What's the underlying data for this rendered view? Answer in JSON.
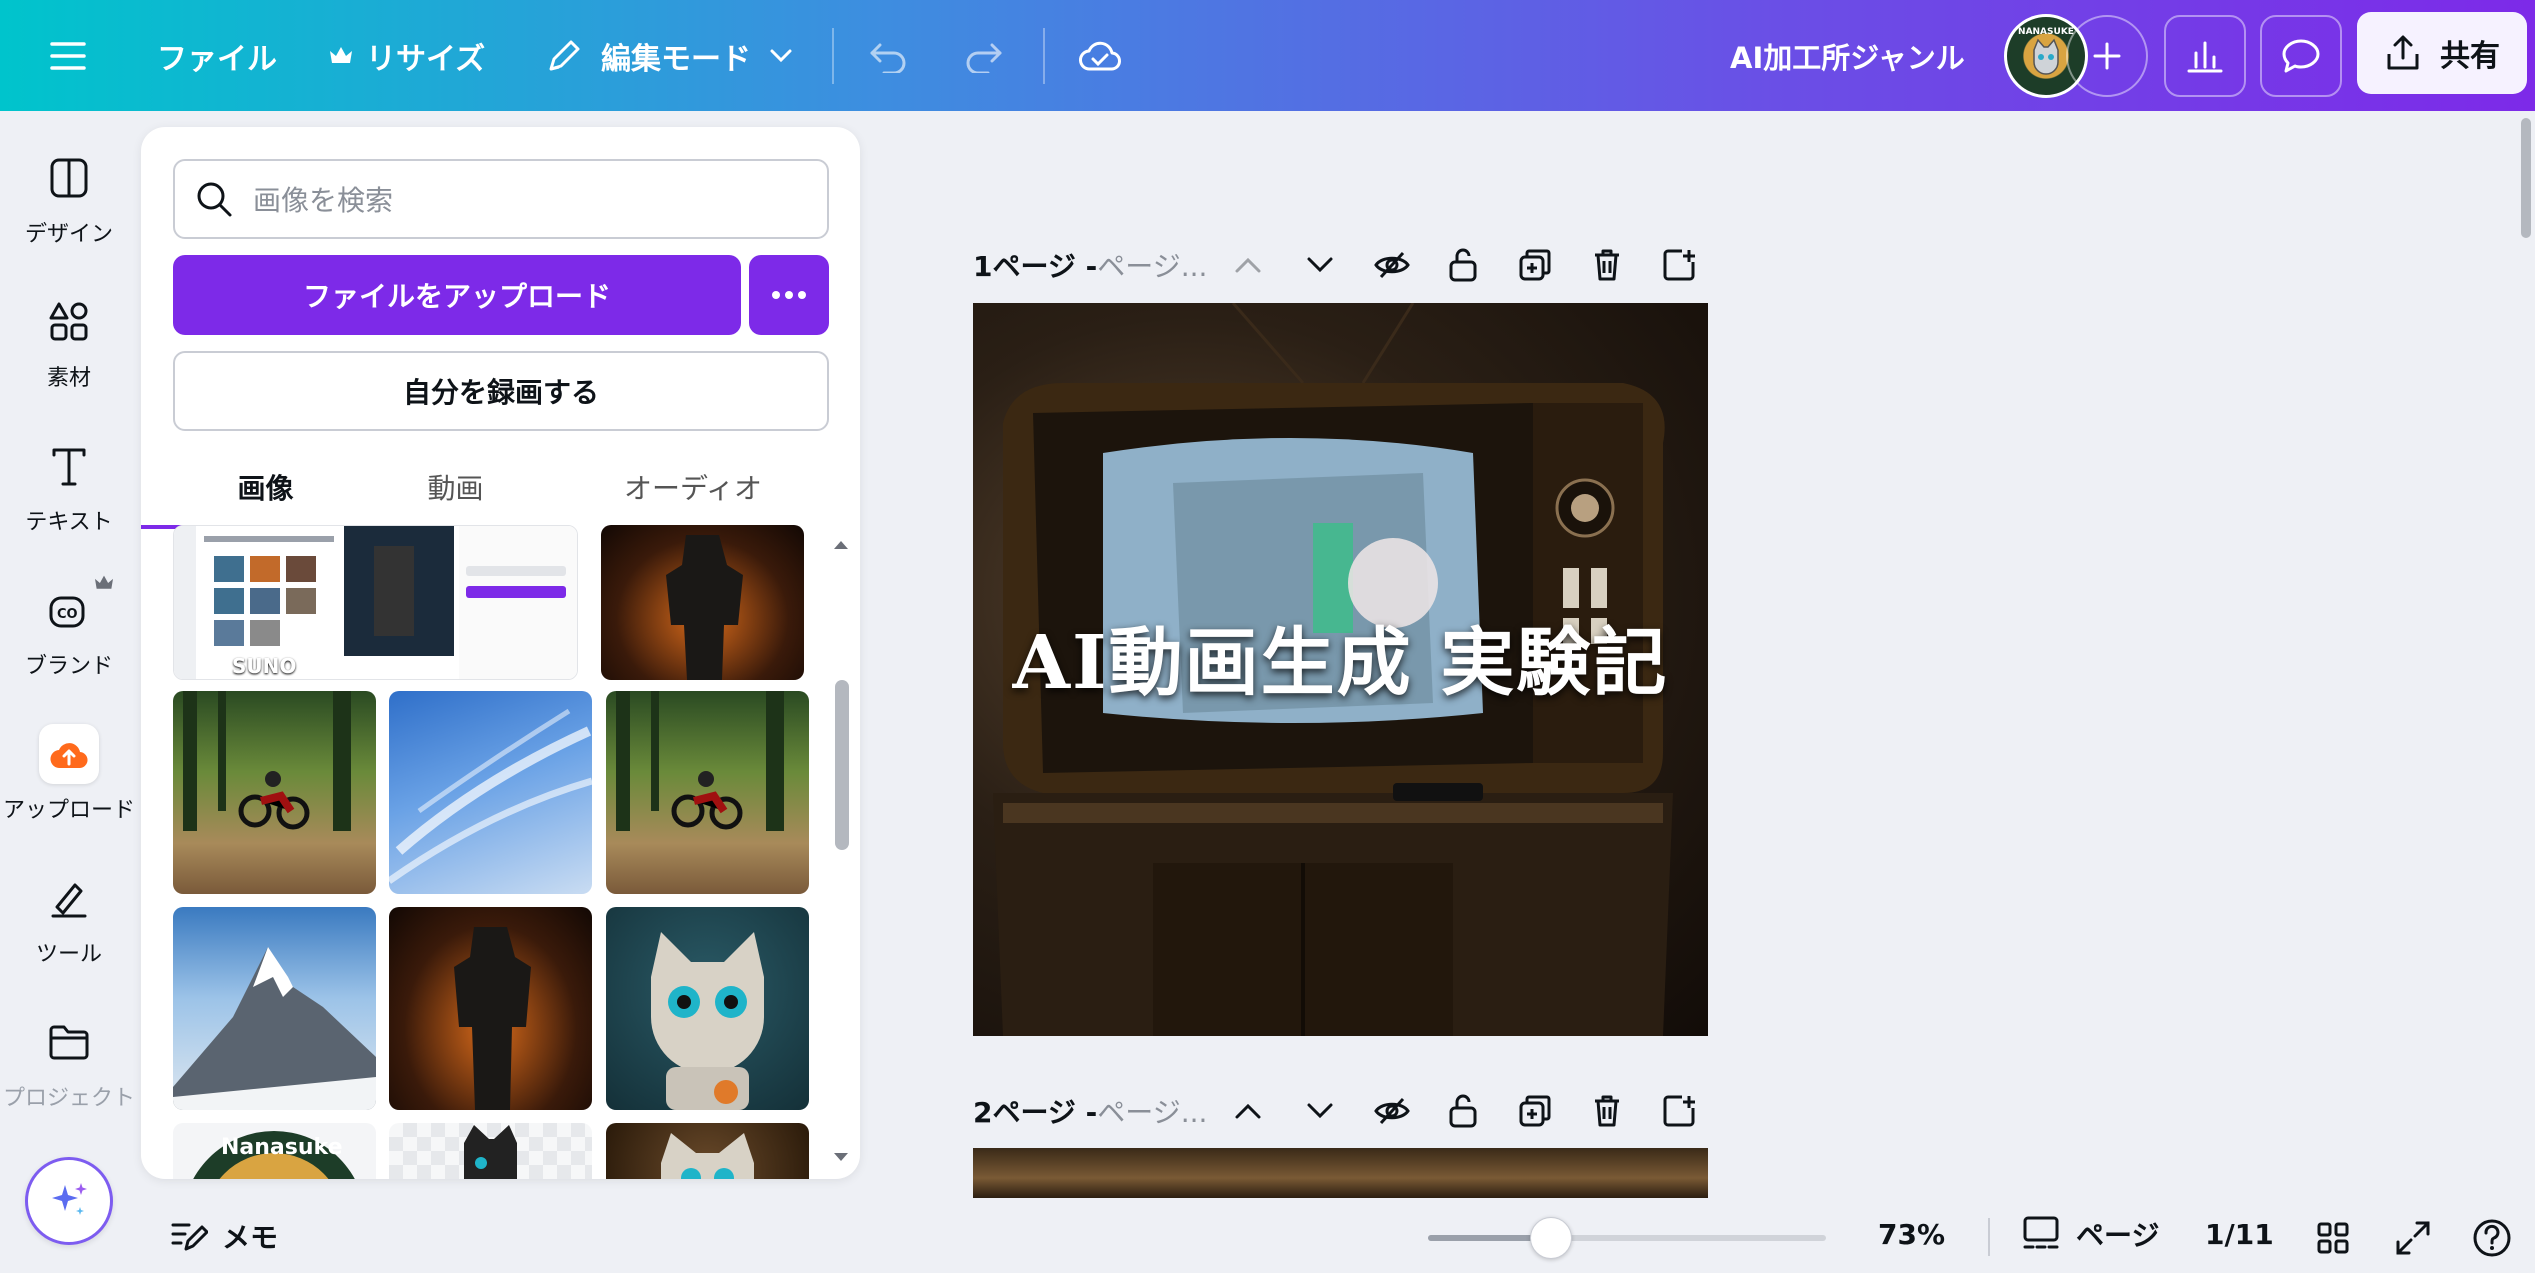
{
  "topbar": {
    "file": "ファイル",
    "resize": "リサイズ",
    "edit_mode": "編集モード",
    "project_name": "AI加工所ジャンル",
    "share": "共有",
    "avatar_text": "NANASUKE"
  },
  "rail": {
    "items": [
      {
        "label": "デザイン",
        "icon": "design-icon"
      },
      {
        "label": "素材",
        "icon": "elements-icon"
      },
      {
        "label": "テキスト",
        "icon": "text-icon"
      },
      {
        "label": "ブランド",
        "icon": "brand-icon"
      },
      {
        "label": "アップロード",
        "icon": "upload-icon"
      },
      {
        "label": "ツール",
        "icon": "tools-icon"
      },
      {
        "label": "プロジェクト",
        "icon": "folder-icon"
      }
    ]
  },
  "panel": {
    "search_placeholder": "画像を検索",
    "upload_label": "ファイルをアップロード",
    "record_label": "自分を録画する",
    "tabs": [
      "画像",
      "動画",
      "オーディオ"
    ],
    "active_tab": "画像",
    "thumb_labels": {
      "suno": "SUNO",
      "nanasuke": "Nanasuke"
    }
  },
  "canvas": {
    "page1_name": "1ページ - ",
    "page1_sub": "ページ...",
    "page2_name": "2ページ - ",
    "page2_sub": "ページ...",
    "page1_title": "AI動画生成 実験記"
  },
  "bottom": {
    "memo": "メモ",
    "zoom": "73%",
    "zoom_fraction": 0.31,
    "pages_label": "ページ",
    "page_count": "1/11"
  },
  "colors": {
    "accent": "#7d2ae8",
    "upload_rail": "#ff6a1c"
  }
}
